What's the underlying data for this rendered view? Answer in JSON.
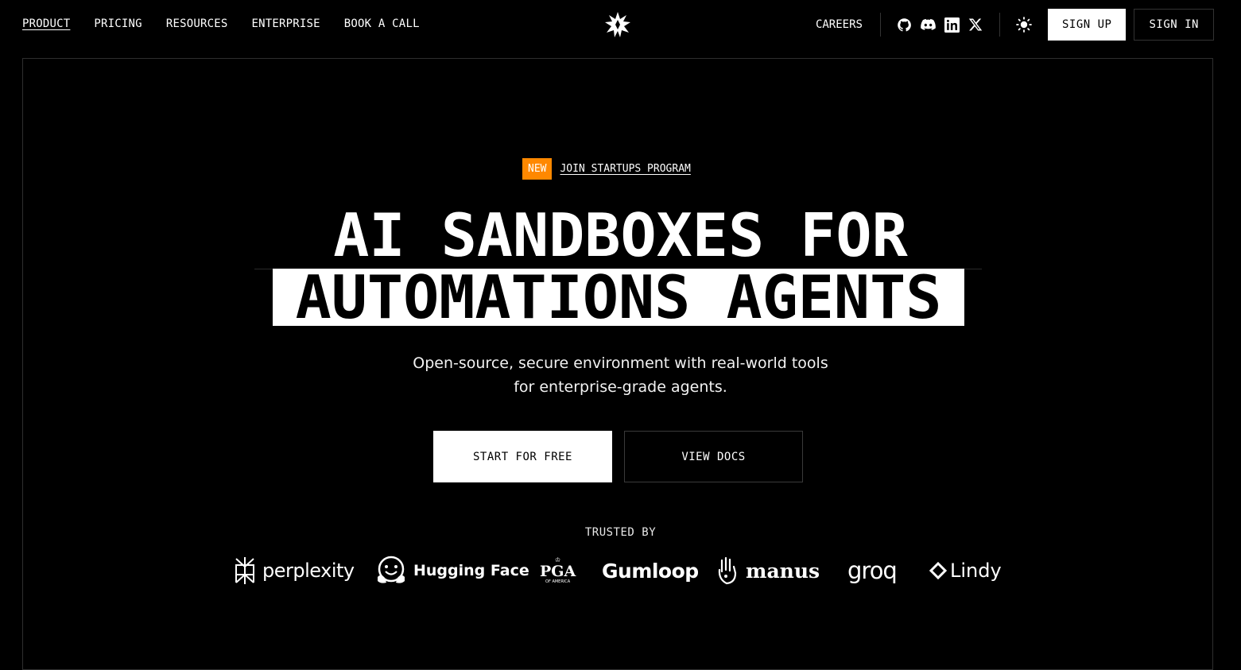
{
  "nav": {
    "links": [
      {
        "label": "PRODUCT"
      },
      {
        "label": "PRICING"
      },
      {
        "label": "RESOURCES"
      },
      {
        "label": "ENTERPRISE"
      },
      {
        "label": "BOOK A CALL"
      }
    ],
    "careers": "CAREERS",
    "sign_up": "SIGN UP",
    "sign_in": "SIGN IN",
    "social_icons": [
      "github-icon",
      "discord-icon",
      "linkedin-icon",
      "x-icon"
    ],
    "theme_icon": "sun-icon"
  },
  "hero": {
    "badge": "NEW",
    "badge_link": "JOIN STARTUPS PROGRAM",
    "headline_line1": "AI SANDBOXES FOR",
    "headline_line2": "AUTOMATIONS AGENTS",
    "subtitle_line1": "Open-source, secure environment with real-world tools",
    "subtitle_line2": "for enterprise-grade agents.",
    "cta_primary": "START FOR FREE",
    "cta_secondary": "VIEW DOCS",
    "trusted_by": "TRUSTED BY"
  },
  "logos": [
    {
      "name": "perplexity"
    },
    {
      "name": "Hugging Face"
    },
    {
      "name": "PGA",
      "sub": "OF AMERICA"
    },
    {
      "name": "Gumloop"
    },
    {
      "name": "manus"
    },
    {
      "name": "groq"
    },
    {
      "name": "Lindy"
    }
  ],
  "colors": {
    "background": "#000000",
    "accent_badge": "#ff8800",
    "primary_button": "#ffffff",
    "border": "#2e2e2e"
  }
}
